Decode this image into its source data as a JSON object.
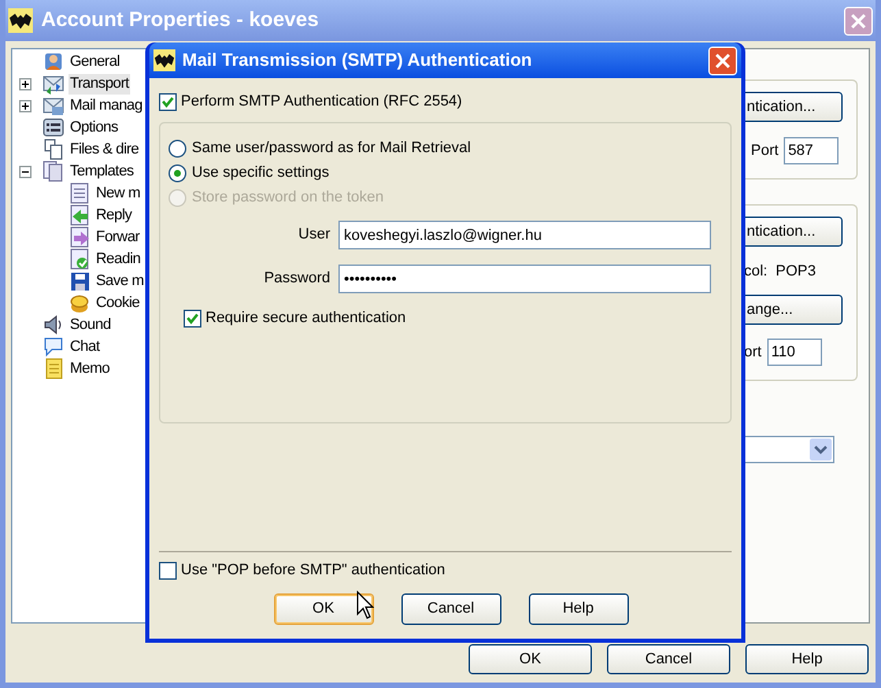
{
  "window": {
    "title": "Account Properties - koeves"
  },
  "tree": [
    {
      "label": "General",
      "selected": false
    },
    {
      "label": "Transport",
      "selected": true,
      "expanded": false
    },
    {
      "label": "Mail manag",
      "selected": false,
      "expanded": false
    },
    {
      "label": "Options",
      "selected": false
    },
    {
      "label": "Files & dire",
      "selected": false
    },
    {
      "label": "Templates",
      "selected": false,
      "expanded": true,
      "children": [
        {
          "label": "New m",
          "selected": false
        },
        {
          "label": "Reply",
          "selected": false
        },
        {
          "label": "Forwar",
          "selected": false
        },
        {
          "label": "Readin",
          "selected": false
        },
        {
          "label": "Save m",
          "selected": false
        },
        {
          "label": "Cookie",
          "selected": false
        }
      ]
    },
    {
      "label": "Sound",
      "selected": false
    },
    {
      "label": "Chat",
      "selected": false
    },
    {
      "label": "Memo",
      "selected": false
    }
  ],
  "right_panel": {
    "smtp_auth_button": "ntication...",
    "smtp_port_label": "Port",
    "smtp_port": "587",
    "pop_auth_button": "ntication...",
    "protocol_label": "col:",
    "protocol_value": "POP3",
    "change_button": "ange...",
    "pop_port_label": "ort",
    "pop_port": "110"
  },
  "buttons": [
    {
      "label": "OK"
    },
    {
      "label": "Cancel"
    },
    {
      "label": "Help"
    }
  ],
  "dialog": {
    "title": "Mail Transmission (SMTP) Authentication",
    "perform_auth": {
      "label": "Perform SMTP Authentication (RFC 2554)",
      "checked": true
    },
    "modes": [
      {
        "label": "Same user/password as for Mail Retrieval",
        "selected": false,
        "disabled": false
      },
      {
        "label": "Use specific settings",
        "selected": true,
        "disabled": false
      },
      {
        "label": "Store password on the token",
        "selected": false,
        "disabled": true
      }
    ],
    "user": {
      "label": "User",
      "value": "koveshegyi.laszlo@wigner.hu"
    },
    "password": {
      "label": "Password",
      "value": "••••••••••"
    },
    "require_secure": {
      "label": "Require secure authentication",
      "checked": true
    },
    "pop_before_smtp": {
      "label": "Use \"POP before SMTP\" authentication",
      "checked": false
    },
    "buttons": [
      {
        "label": "OK",
        "focused": true
      },
      {
        "label": "Cancel",
        "focused": false
      },
      {
        "label": "Help",
        "focused": false
      }
    ]
  }
}
